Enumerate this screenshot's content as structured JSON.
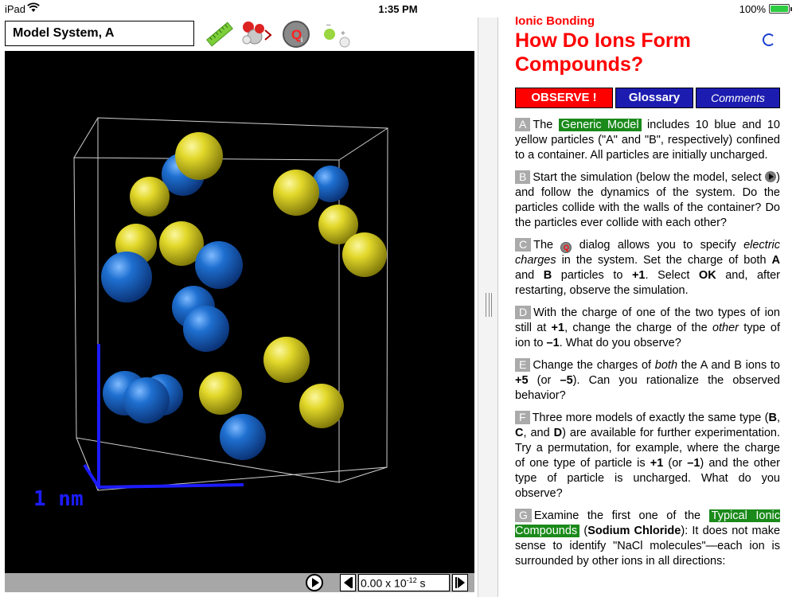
{
  "status": {
    "device": "iPad",
    "time": "1:35 PM",
    "battery": "100%"
  },
  "model": {
    "title": "Model System, A",
    "tools": [
      {
        "icon": "ruler-icon"
      },
      {
        "icon": "molecule-icon"
      },
      {
        "icon": "charge-q-icon",
        "label": "Q"
      },
      {
        "icon": "particle-charge-icon"
      }
    ],
    "scale_label": "1 nm",
    "time_value": "0.00 x 10",
    "time_exp": "-12",
    "time_unit": " s",
    "colors": {
      "blue": "#1e6fd0",
      "yellow": "#e2d82a",
      "axis": "#1c1cff"
    }
  },
  "lesson": {
    "subject": "Ionic Bonding",
    "title": "How Do Ions Form Compounds?",
    "tabs": {
      "observe": "OBSERVE !",
      "glossary": "Glossary",
      "comments": "Comments"
    },
    "items": [
      {
        "letter": "A"
      },
      {
        "letter": "B"
      },
      {
        "letter": "C"
      },
      {
        "letter": "D"
      },
      {
        "letter": "E"
      },
      {
        "letter": "F"
      },
      {
        "letter": "G"
      }
    ],
    "a": {
      "t1": "The ",
      "hl": "Generic Model",
      "t2": " includes 10 blue and 10 yellow particles (\"A\" and \"B\", respectively) confined to a container. All particles are initially uncharged."
    },
    "b": {
      "t1": "Start the simulation (below the model, select ",
      "t2": ") and follow the dynamics of the system. Do the particles collide with the walls of the container? Do the particles ever collide with each other?"
    },
    "c": {
      "t1": "The ",
      "t2": " dialog allows you to specify ",
      "em1": "electric charges",
      "t3": " in the system. Set the charge of both ",
      "b1": "A",
      "t4": " and ",
      "b2": "B",
      "t5": " particles to ",
      "b3": "+1",
      "t6": ". Select ",
      "b4": "OK",
      "t7": " and, after restarting, observe the simulation."
    },
    "d": {
      "t1": "With the charge of one of the two types of ion still at ",
      "b1": "+1",
      "t2": ", change the charge of the ",
      "em1": "other",
      "t3": " type of ion to ",
      "b2": "–1",
      "t4": ". What do you observe?"
    },
    "e": {
      "t1": "Change the charges of ",
      "em1": "both",
      "t2": " the A and B ions to ",
      "b1": "+5",
      "t3": " (or ",
      "b2": "–5",
      "t4": "). Can you rationalize the observed behavior?"
    },
    "f": {
      "t1": "Three more models of exactly the same type (",
      "b1": "B",
      "t2": ", ",
      "b2": "C",
      "t3": ", and ",
      "b3": "D",
      "t4": ") are available for further experimentation. Try a permutation, for example, where the charge of one type of particle is ",
      "b4": "+1",
      "t5": " (or ",
      "b5": "–1",
      "t6": ") and the other type of particle is uncharged. What do you observe?"
    },
    "g": {
      "t1": "Examine the first one of the ",
      "hl": "Typical Ionic Compounds",
      "t2": " (",
      "b1": "Sodium Chloride",
      "t3": "): It does not make sense to identify \"NaCl molecules\"—each ion is surrounded by other ions in all directions:"
    }
  }
}
